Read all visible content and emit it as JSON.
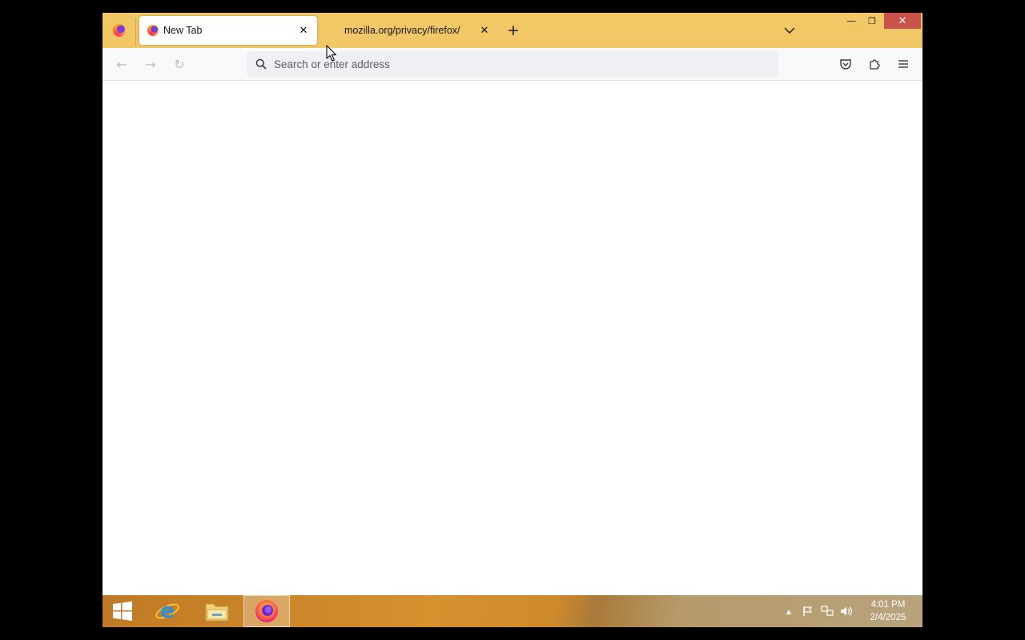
{
  "browser": {
    "tabs": [
      {
        "label": "New Tab",
        "active": true,
        "icon": "firefox-icon"
      },
      {
        "label": "mozilla.org/privacy/firefox/",
        "active": false
      }
    ],
    "window_controls": {
      "minimize": "—",
      "restore": "❐",
      "close": "✕"
    }
  },
  "toolbar": {
    "back": "←",
    "forward": "→",
    "reload": "↻",
    "address_placeholder": "Search or enter address",
    "address_value": ""
  },
  "taskbar": {
    "apps": [
      "start-icon",
      "internet-explorer-icon",
      "file-explorer-icon",
      "firefox-icon"
    ],
    "clock": {
      "time": "4:01 PM",
      "date": "2/4/2025"
    }
  },
  "colors": {
    "tabbar": "#f1c865",
    "close_button": "#c9524b",
    "taskbar_accent": "#d6902e"
  }
}
